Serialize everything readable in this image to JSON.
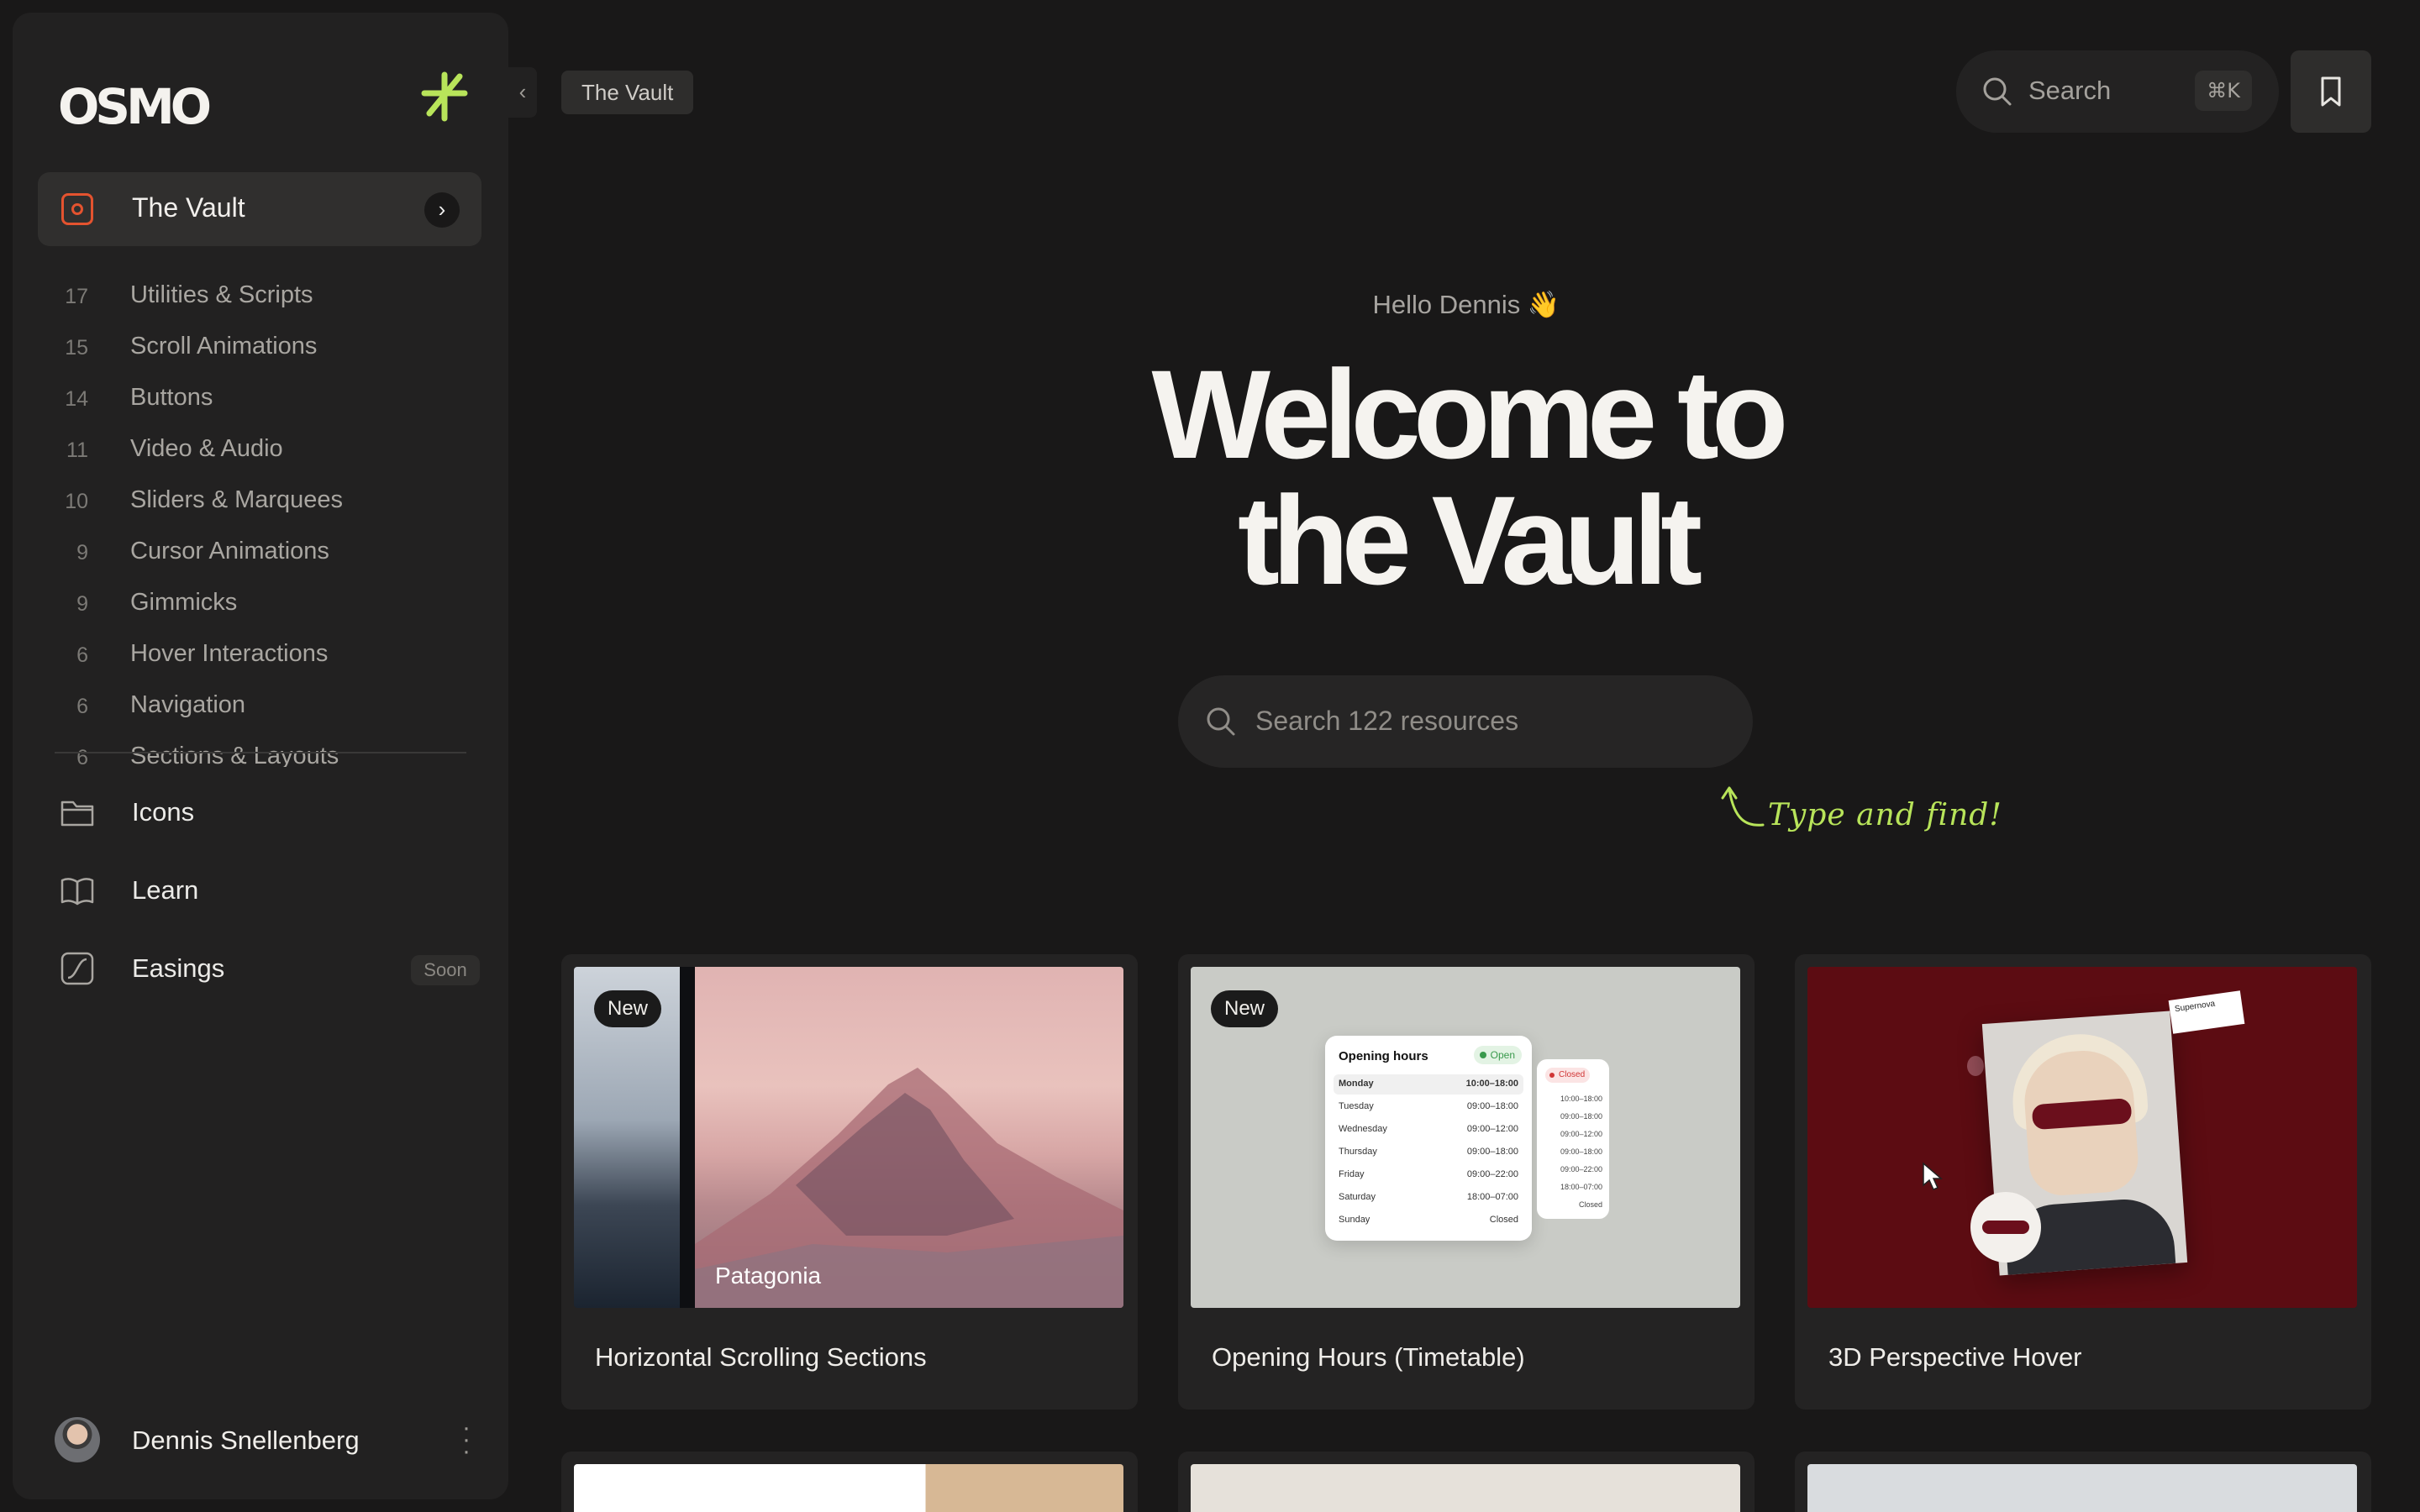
{
  "sidebar": {
    "logo": "OSMO",
    "vault_label": "The Vault",
    "categories": [
      {
        "count": "17",
        "label": "Utilities & Scripts"
      },
      {
        "count": "15",
        "label": "Scroll Animations"
      },
      {
        "count": "14",
        "label": "Buttons"
      },
      {
        "count": "11",
        "label": "Video & Audio"
      },
      {
        "count": "10",
        "label": "Sliders & Marquees"
      },
      {
        "count": "9",
        "label": "Cursor Animations"
      },
      {
        "count": "9",
        "label": "Gimmicks"
      },
      {
        "count": "6",
        "label": "Hover Interactions"
      },
      {
        "count": "6",
        "label": "Navigation"
      },
      {
        "count": "6",
        "label": "Sections & Layouts"
      }
    ],
    "nav": [
      {
        "label": "Icons",
        "icon": "folder-icon"
      },
      {
        "label": "Learn",
        "icon": "book-icon"
      },
      {
        "label": "Easings",
        "icon": "curve-icon",
        "badge": "Soon"
      }
    ],
    "user": {
      "name": "Dennis Snellenberg"
    }
  },
  "topbar": {
    "breadcrumb": "The Vault",
    "search_label": "Search",
    "search_shortcut": "⌘K"
  },
  "hero": {
    "greeting": "Hello Dennis 👋",
    "title_line1": "Welcome to",
    "title_line2": "the Vault",
    "search_placeholder": "Search 122 resources",
    "hint": "Type and find!"
  },
  "cards": [
    {
      "title": "Horizontal Scrolling Sections",
      "badge": "New",
      "thumb_label": "Patagonia"
    },
    {
      "title": "Opening Hours (Timetable)",
      "badge": "New"
    },
    {
      "title": "3D Perspective Hover"
    }
  ],
  "timetable": {
    "title": "Opening hours",
    "status": "Open",
    "rows": [
      {
        "day": "Monday",
        "hours": "10:00–18:00"
      },
      {
        "day": "Tuesday",
        "hours": "09:00–18:00"
      },
      {
        "day": "Wednesday",
        "hours": "09:00–12:00"
      },
      {
        "day": "Thursday",
        "hours": "09:00–18:00"
      },
      {
        "day": "Friday",
        "hours": "09:00–22:00"
      },
      {
        "day": "Saturday",
        "hours": "18:00–07:00"
      },
      {
        "day": "Sunday",
        "hours": "Closed"
      }
    ],
    "secondary_status": "Closed",
    "secondary_rows": [
      "10:00–18:00",
      "09:00–18:00",
      "09:00–12:00",
      "09:00–18:00",
      "09:00–22:00",
      "18:00–07:00",
      "Closed"
    ]
  },
  "perspective_tag": "Supernova",
  "colors": {
    "accent_green": "#b8e45a",
    "vault_icon": "#e4532f",
    "background": "#191818",
    "sidebar": "#222121"
  }
}
